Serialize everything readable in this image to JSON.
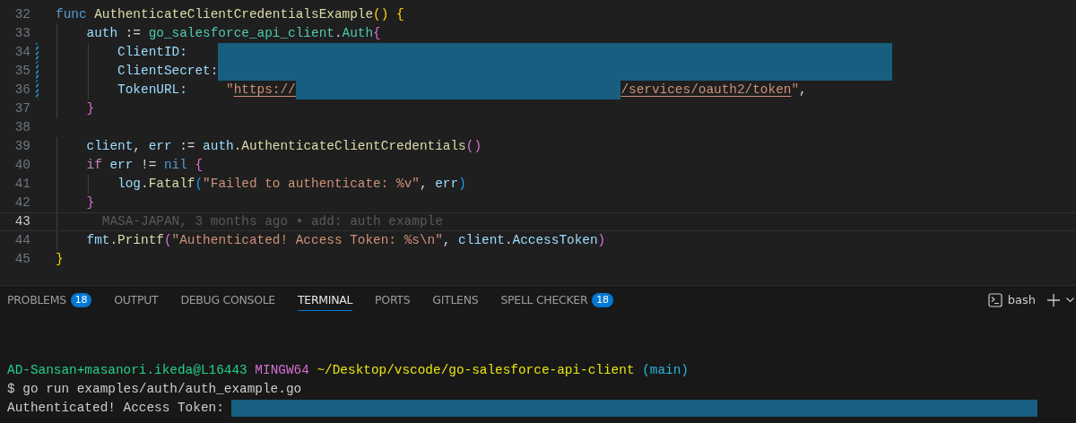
{
  "editor": {
    "lines": [
      {
        "number": "32",
        "current": false,
        "modified": false,
        "tokens": [
          {
            "kind": "keyword",
            "text": "func "
          },
          {
            "kind": "function",
            "text": "AuthenticateClientCredentialsExample"
          },
          {
            "kind": "bracket1",
            "text": "() {"
          }
        ]
      },
      {
        "number": "33",
        "current": false,
        "modified": false,
        "tokens": [
          {
            "kind": "variable",
            "text": "    auth"
          },
          {
            "kind": "plain",
            "text": " := "
          },
          {
            "kind": "type",
            "text": "go_salesforce_api_client"
          },
          {
            "kind": "plain",
            "text": "."
          },
          {
            "kind": "type",
            "text": "Auth"
          },
          {
            "kind": "bracket2",
            "text": "{"
          }
        ]
      },
      {
        "number": "34",
        "current": false,
        "modified": true,
        "tokens": [
          {
            "kind": "variable",
            "text": "        ClientID:    "
          },
          {
            "kind": "redaction"
          }
        ]
      },
      {
        "number": "35",
        "current": false,
        "modified": true,
        "tokens": [
          {
            "kind": "variable",
            "text": "        ClientSecret:"
          },
          {
            "kind": "redaction"
          }
        ]
      },
      {
        "number": "36",
        "current": false,
        "modified": true,
        "tokens": [
          {
            "kind": "variable",
            "text": "        TokenURL:     "
          },
          {
            "kind": "string",
            "text": "\""
          },
          {
            "kind": "link",
            "text": "https://"
          },
          {
            "kind": "redaction"
          },
          {
            "kind": "link",
            "text": "/services/oauth2/token"
          },
          {
            "kind": "string",
            "text": "\""
          },
          {
            "kind": "plain",
            "text": ","
          }
        ]
      },
      {
        "number": "37",
        "current": false,
        "modified": false,
        "tokens": [
          {
            "kind": "bracket2",
            "text": "    }"
          }
        ]
      },
      {
        "number": "38",
        "current": false,
        "modified": false
      },
      {
        "number": "39",
        "current": false,
        "modified": false,
        "tokens": [
          {
            "kind": "variable",
            "text": "    client"
          },
          {
            "kind": "plain",
            "text": ", "
          },
          {
            "kind": "variable",
            "text": "err"
          },
          {
            "kind": "plain",
            "text": " := "
          },
          {
            "kind": "variable",
            "text": "auth"
          },
          {
            "kind": "plain",
            "text": "."
          },
          {
            "kind": "function",
            "text": "AuthenticateClientCredentials"
          },
          {
            "kind": "bracket2",
            "text": "()"
          }
        ]
      },
      {
        "number": "40",
        "current": false,
        "modified": false,
        "tokens": [
          {
            "kind": "control",
            "text": "    if "
          },
          {
            "kind": "variable",
            "text": "err"
          },
          {
            "kind": "plain",
            "text": " != "
          },
          {
            "kind": "keyword",
            "text": "nil "
          },
          {
            "kind": "bracket2",
            "text": "{"
          }
        ]
      },
      {
        "number": "41",
        "current": false,
        "modified": false,
        "tokens": [
          {
            "kind": "variable",
            "text": "        log"
          },
          {
            "kind": "plain",
            "text": "."
          },
          {
            "kind": "function",
            "text": "Fatalf"
          },
          {
            "kind": "bracket3",
            "text": "("
          },
          {
            "kind": "string",
            "text": "\"Failed to authenticate: %v\""
          },
          {
            "kind": "plain",
            "text": ", "
          },
          {
            "kind": "variable",
            "text": "err"
          },
          {
            "kind": "bracket3",
            "text": ")"
          }
        ]
      },
      {
        "number": "42",
        "current": false,
        "modified": false,
        "tokens": [
          {
            "kind": "bracket2",
            "text": "    }"
          }
        ]
      },
      {
        "number": "43",
        "current": true,
        "modified": false,
        "tokens": [
          {
            "kind": "blame",
            "text": "      MASA-JAPAN, 3 months ago • add: auth example"
          }
        ]
      },
      {
        "number": "44",
        "current": false,
        "modified": false,
        "tokens": [
          {
            "kind": "variable",
            "text": "    fmt"
          },
          {
            "kind": "plain",
            "text": "."
          },
          {
            "kind": "function",
            "text": "Printf"
          },
          {
            "kind": "bracket2",
            "text": "("
          },
          {
            "kind": "string",
            "text": "\"Authenticated! Access Token: %s\\n\""
          },
          {
            "kind": "plain",
            "text": ", "
          },
          {
            "kind": "variable",
            "text": "client"
          },
          {
            "kind": "plain",
            "text": "."
          },
          {
            "kind": "variable",
            "text": "AccessToken"
          },
          {
            "kind": "bracket2",
            "text": ")"
          }
        ]
      },
      {
        "number": "45",
        "current": false,
        "modified": false,
        "tokens": [
          {
            "kind": "bracket1",
            "text": "}"
          }
        ]
      }
    ]
  },
  "panel": {
    "tabs": [
      {
        "label": "PROBLEMS",
        "badge": "18",
        "selected": false
      },
      {
        "label": "OUTPUT",
        "selected": false
      },
      {
        "label": "DEBUG CONSOLE",
        "selected": false
      },
      {
        "label": "TERMINAL",
        "selected": true
      },
      {
        "label": "PORTS",
        "selected": false
      },
      {
        "label": "GITLENS",
        "selected": false
      },
      {
        "label": "SPELL CHECKER",
        "badge": "18",
        "selected": false
      }
    ],
    "terminal_name": "bash"
  },
  "terminal": {
    "lines": [
      [
        {
          "kind": "user",
          "text": "AD-Sansan+masanori.ikeda@L16443 "
        },
        {
          "kind": "env",
          "text": "MINGW64 "
        },
        {
          "kind": "path",
          "text": "~/Desktop/vscode/go-salesforce-api-client "
        },
        {
          "kind": "branch",
          "text": "(main)"
        }
      ],
      [
        {
          "kind": "plain",
          "text": "$ go run examples/auth/auth_example.go"
        }
      ],
      [
        {
          "kind": "plain",
          "text": "Authenticated! Access Token: "
        },
        {
          "kind": "redaction"
        }
      ]
    ]
  }
}
